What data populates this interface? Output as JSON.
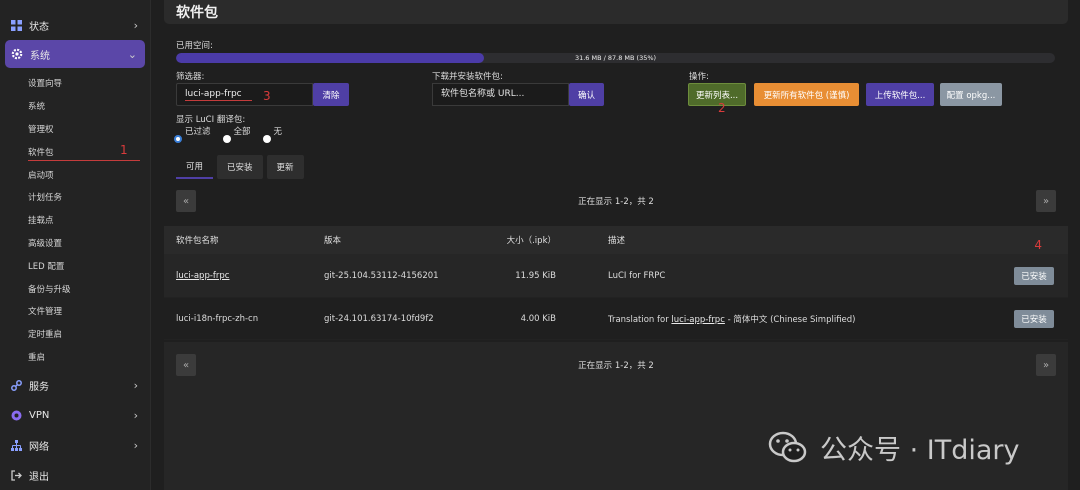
{
  "sidebar": {
    "status": "状态",
    "system": "系统",
    "sub_items": [
      "设置向导",
      "系统",
      "管理权",
      "软件包",
      "启动项",
      "计划任务",
      "挂载点",
      "高级设置",
      "LED 配置",
      "备份与升级",
      "文件管理",
      "定时重启",
      "重启"
    ],
    "current_index": 3,
    "current_mark": "1",
    "services": "服务",
    "vpn": "VPN",
    "network": "网络",
    "logout": "退出"
  },
  "page": {
    "title": "软件包"
  },
  "storage": {
    "label": "已用空间:",
    "text": "31.6 MB / 87.8 MB (35%)",
    "percent": 35
  },
  "filter": {
    "label": "筛选器:",
    "value": "luci-app-frpc",
    "clear": "清除",
    "mark": "3"
  },
  "download": {
    "label": "下载并安装软件包:",
    "placeholder": "软件包名称或 URL...",
    "confirm": "确认"
  },
  "ops": {
    "label": "操作:",
    "update_lists": "更新列表...",
    "upgrade_all": "更新所有软件包 (谨慎)",
    "upload": "上传软件包...",
    "configure": "配置 opkg...",
    "mark": "2"
  },
  "lang": {
    "label": "显示 LuCI 翻译包:",
    "options": [
      "已过滤",
      "全部",
      "无"
    ],
    "selected": 0
  },
  "tabs": [
    "可用",
    "已安装",
    "更新"
  ],
  "pager": {
    "prev": "«",
    "next": "»",
    "text": "正在显示 1-2，共 2"
  },
  "table": {
    "headers": [
      "软件包名称",
      "版本",
      "大小（.ipk）",
      "描述"
    ],
    "rows": [
      {
        "name": "luci-app-frpc",
        "version": "git-25.104.53112-4156201",
        "size": "11.95 KiB",
        "desc": "LuCI for FRPC",
        "action": "已安装"
      },
      {
        "name": "luci-i18n-frpc-zh-cn",
        "version": "git-24.101.63174-10fd9f2",
        "size": "4.00 KiB",
        "desc_prefix": "Translation for ",
        "desc_link": "luci-app-frpc",
        "desc_suffix": " - 简体中文 (Chinese Simplified)",
        "action": "已安装"
      }
    ],
    "mark": "4"
  },
  "watermark": {
    "text": "公众号 · ITdiary"
  },
  "colors": {
    "accent": "#5b47a8",
    "orange": "#e88e34",
    "olive": "#4f6b2a",
    "gray_button": "#8b97a3",
    "annotation": "#d93b3b"
  }
}
